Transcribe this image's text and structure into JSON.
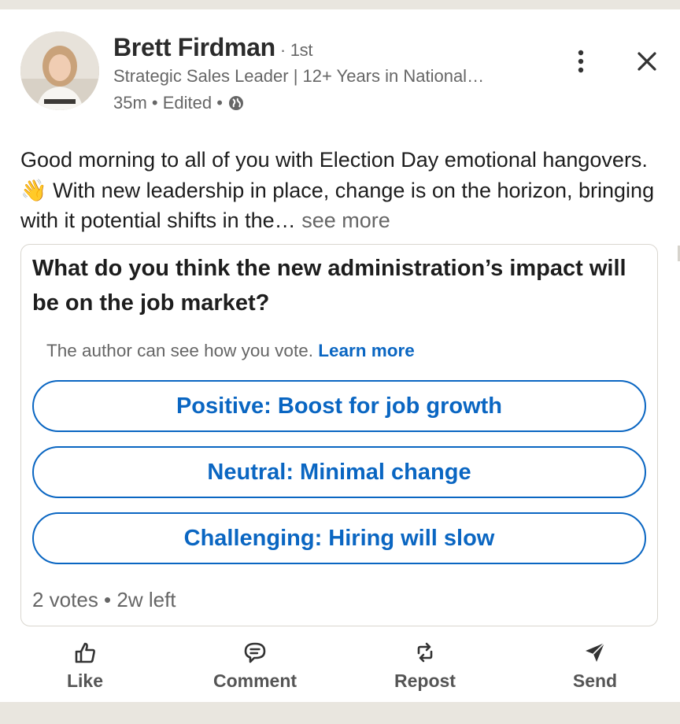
{
  "post": {
    "author": {
      "name": "Brett Firdman",
      "degree": "· 1st",
      "headline": "Strategic Sales Leader | 12+ Years in National…",
      "meta": "35m • Edited •",
      "visibility_icon": "globe-icon"
    },
    "text_main": "Good morning to all of you with Election Day emotional hangovers. 👋 With new leadership in place, change is on the horizon, bringing with it potential shifts in the…",
    "see_more": "see more"
  },
  "poll": {
    "question": "What do you think the new administration’s impact will be on the job market?",
    "notice": "The author can see how you vote.",
    "learn_more": "Learn more",
    "options": [
      {
        "label": "Positive: Boost for job growth"
      },
      {
        "label": "Neutral: Minimal change"
      },
      {
        "label": "Challenging: Hiring will slow"
      }
    ],
    "footer": "2 votes • 2w left"
  },
  "actions": [
    {
      "label": "Like",
      "icon": "thumbs-up-icon"
    },
    {
      "label": "Comment",
      "icon": "comment-icon"
    },
    {
      "label": "Repost",
      "icon": "repost-icon"
    },
    {
      "label": "Send",
      "icon": "send-icon"
    }
  ],
  "colors": {
    "accent": "#0a66c2",
    "muted_text": "#666666",
    "page_bg": "#e9e6df"
  }
}
